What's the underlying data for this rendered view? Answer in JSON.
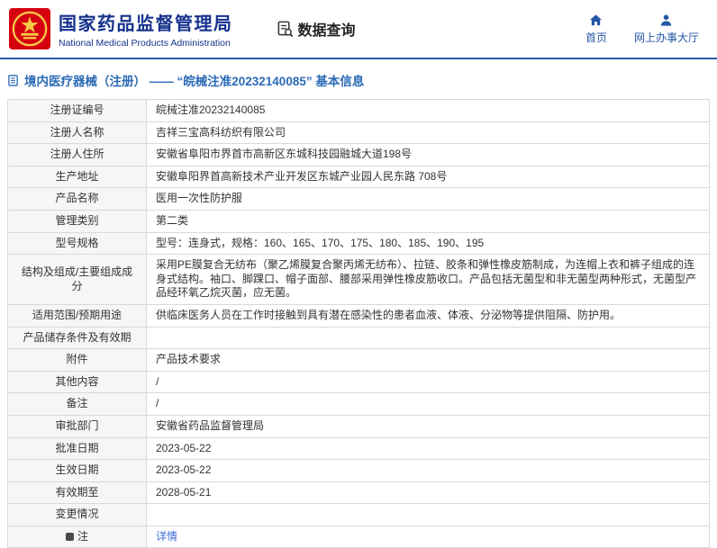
{
  "header": {
    "org_name_cn": "国家药品监督管理局",
    "org_name_en": "National Medical Products Administration",
    "section_title": "数据查询",
    "nav_home": "首页",
    "nav_hall": "网上办事大厅"
  },
  "breadcrumb": "境内医疗器械（注册） —— “皖械注准20232140085” 基本信息",
  "table": {
    "rows": [
      {
        "label": "注册证编号",
        "value": "皖械注准20232140085"
      },
      {
        "label": "注册人名称",
        "value": "吉祥三宝高科纺织有限公司"
      },
      {
        "label": "注册人住所",
        "value": "安徽省阜阳市界首市高新区东城科技园融城大道198号"
      },
      {
        "label": "生产地址",
        "value": "安徽阜阳界首高新技术产业开发区东城产业园人民东路 708号"
      },
      {
        "label": "产品名称",
        "value": "医用一次性防护服"
      },
      {
        "label": "管理类别",
        "value": "第二类"
      },
      {
        "label": "型号规格",
        "value": "型号：连身式，规格：160、165、170、175、180、185、190、195"
      },
      {
        "label": "结构及组成/主要组成成分",
        "value": "采用PE膜复合无纺布（聚乙烯膜复合聚丙烯无纺布）、拉链、胶条和弹性橡皮筋制成，为连帽上衣和裤子组成的连身式结构。袖口、脚踝口、帽子面部、腰部采用弹性橡皮筋收口。产品包括无菌型和非无菌型两种形式，无菌型产品经环氧乙烷灭菌，应无菌。"
      },
      {
        "label": "适用范围/预期用途",
        "value": "供临床医务人员在工作时接触到具有潜在感染性的患者血液、体液、分泌物等提供阻隔、防护用。"
      },
      {
        "label": "产品储存条件及有效期",
        "value": ""
      },
      {
        "label": "附件",
        "value": "产品技术要求"
      },
      {
        "label": "其他内容",
        "value": "/"
      },
      {
        "label": "备注",
        "value": "/"
      },
      {
        "label": "审批部门",
        "value": "安徽省药品监督管理局"
      },
      {
        "label": "批准日期",
        "value": "2023-05-22"
      },
      {
        "label": "生效日期",
        "value": "2023-05-22"
      },
      {
        "label": "有效期至",
        "value": "2028-05-21"
      },
      {
        "label": "变更情况",
        "value": ""
      },
      {
        "label": "注",
        "value": "详情"
      }
    ]
  },
  "colors": {
    "brand_blue": "#15318d",
    "nav_blue": "#2457a6",
    "divider_blue": "#2c5aa2",
    "breadcrumb_blue": "#2a6ab5",
    "link_blue": "#3a6bd8",
    "emblem_red": "#d6000f",
    "emblem_gold": "#f7c948",
    "label_bg": "#f6f6f6",
    "table_border": "#d9d9d9"
  }
}
